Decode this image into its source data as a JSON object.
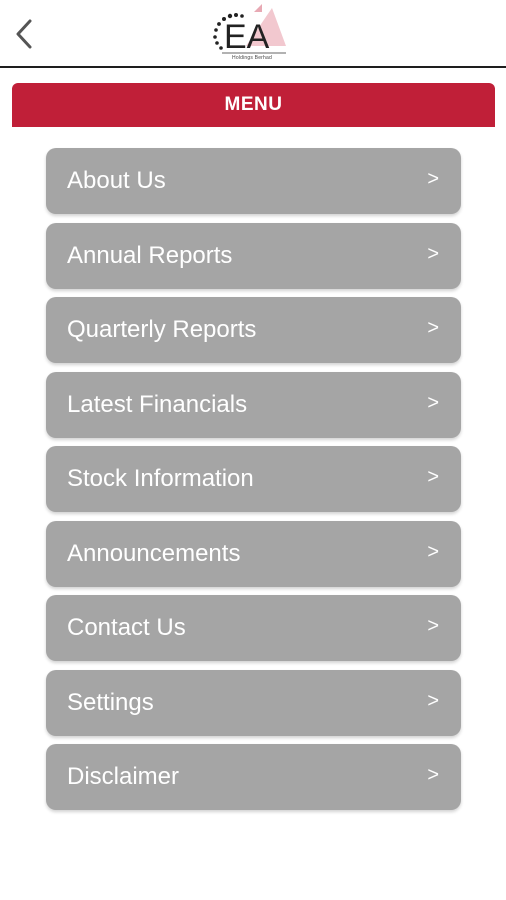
{
  "logo": {
    "letters": "EA",
    "tagline": "Holdings Berhad"
  },
  "header": {
    "title": "MENU"
  },
  "menu": {
    "items": [
      {
        "label": "About Us",
        "chevron": ">"
      },
      {
        "label": "Annual Reports",
        "chevron": ">"
      },
      {
        "label": "Quarterly Reports",
        "chevron": ">"
      },
      {
        "label": "Latest Financials",
        "chevron": ">"
      },
      {
        "label": "Stock Information",
        "chevron": ">"
      },
      {
        "label": "Announcements",
        "chevron": ">"
      },
      {
        "label": "Contact Us",
        "chevron": ">"
      },
      {
        "label": "Settings",
        "chevron": ">"
      },
      {
        "label": "Disclaimer",
        "chevron": ">"
      }
    ]
  },
  "colors": {
    "accent": "#c01f38",
    "menu_item_bg": "#a5a5a5"
  },
  "icons": {
    "back": "back-arrow-icon",
    "logo": "company-logo"
  }
}
